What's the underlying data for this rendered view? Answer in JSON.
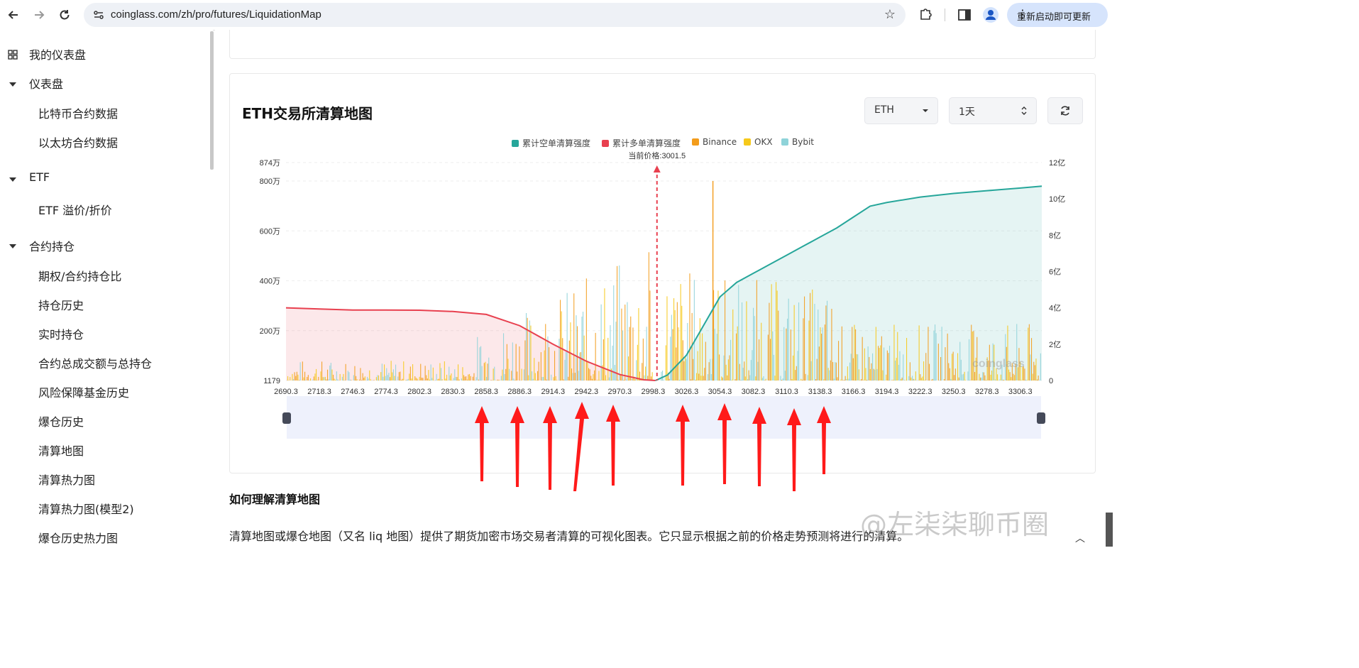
{
  "browser": {
    "url": "coinglass.com/zh/pro/futures/LiquidationMap",
    "update_label": "重新启动即可更新"
  },
  "sidebar": {
    "dashboard": "我的仪表盘",
    "groups": [
      {
        "label": "仪表盘",
        "items": [
          "比特币合约数据",
          "以太坊合约数据"
        ]
      },
      {
        "label": "ETF",
        "items": [
          "ETF 溢价/折价"
        ]
      },
      {
        "label": "合约持仓",
        "items": [
          "期权/合约持仓比",
          "持仓历史",
          "实时持仓",
          "合约总成交额与总持仓",
          "风险保障基金历史",
          "爆仓历史",
          "清算地图",
          "清算热力图",
          "清算热力图(模型2)",
          "爆仓历史热力图"
        ]
      }
    ]
  },
  "card": {
    "title": "ETH交易所清算地图",
    "coin_select": "ETH",
    "period_select": "1天"
  },
  "chart_data": {
    "type": "bar",
    "legend": [
      {
        "name": "累计空单清算强度",
        "color": "#26a69a"
      },
      {
        "name": "累计多单清算强度",
        "color": "#e8404f"
      },
      {
        "name": "Binance",
        "color": "#f39c1b"
      },
      {
        "name": "OKX",
        "color": "#f6c91a"
      },
      {
        "name": "Bybit",
        "color": "#8fd3d9"
      }
    ],
    "current_price_label": "当前价格:3001.5",
    "current_price": 3001.5,
    "y_left_ticks": [
      "874万",
      "800万",
      "600万",
      "400万",
      "200万",
      "1179"
    ],
    "y_left_values": [
      8740000,
      8000000,
      6000000,
      4000000,
      2000000,
      1179
    ],
    "y_right_ticks": [
      "12亿",
      "10亿",
      "8亿",
      "6亿",
      "4亿",
      "2亿",
      "0"
    ],
    "y_right_values": [
      1200000000,
      1000000000,
      800000000,
      600000000,
      400000000,
      200000000,
      0
    ],
    "x_ticks": [
      "2690.3",
      "2718.3",
      "2746.3",
      "2774.3",
      "2802.3",
      "2830.3",
      "2858.3",
      "2886.3",
      "2914.3",
      "2942.3",
      "2970.3",
      "2998.3",
      "3026.3",
      "3054.3",
      "3082.3",
      "3110.3",
      "3138.3",
      "3166.3",
      "3194.3",
      "3222.3",
      "3250.3",
      "3278.3",
      "3306.3"
    ],
    "x_range": [
      2690.3,
      3324.3
    ],
    "long_cumulative": {
      "x": [
        2690.3,
        2718.3,
        2746.3,
        2774.3,
        2802.3,
        2830.3,
        2858.3,
        2886.3,
        2914.3,
        2942.3,
        2970.3,
        2990.3,
        3000.3
      ],
      "y": [
        400000000,
        394000000,
        388000000,
        388000000,
        387000000,
        380000000,
        364000000,
        302000000,
        200000000,
        106000000,
        33000000,
        4000000,
        0
      ]
    },
    "short_cumulative": {
      "x": [
        3000.3,
        3010.3,
        3026.3,
        3040.3,
        3054.3,
        3068.3,
        3082.3,
        3096.3,
        3110.3,
        3124.3,
        3138.3,
        3152.3,
        3166.3,
        3180.3,
        3194.3,
        3222.3,
        3250.3,
        3278.3,
        3306.3,
        3324.3
      ],
      "y": [
        0,
        30000000,
        140000000,
        300000000,
        460000000,
        540000000,
        590000000,
        640000000,
        690000000,
        740000000,
        790000000,
        840000000,
        900000000,
        960000000,
        980000000,
        1010000000,
        1030000000,
        1045000000,
        1060000000,
        1070000000
      ]
    },
    "watermark": "coinglass"
  },
  "section": {
    "title": "如何理解清算地图",
    "text": "清算地图或爆仓地图（又名 liq 地图）提供了期货加密市场交易者清算的可视化图表。它只显示根据之前的价格走势预测将进行的清算。"
  },
  "annotation": {
    "arrow_color": "#ff1a1a",
    "arrow_count": 10,
    "overlay_text": "@左柒柒聊币圈"
  }
}
